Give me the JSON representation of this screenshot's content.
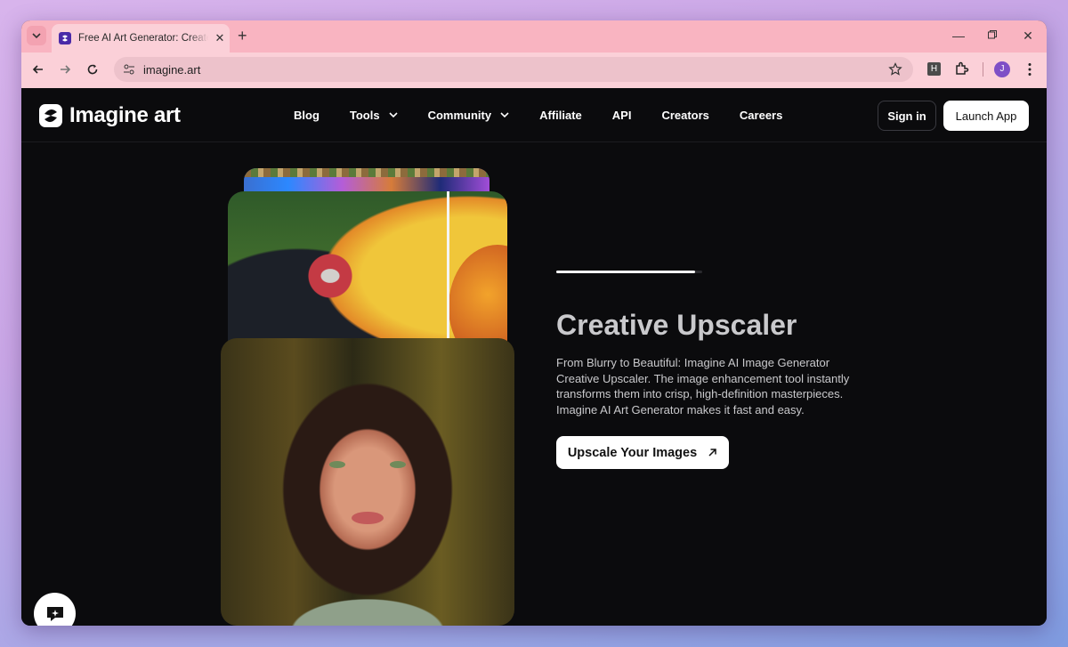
{
  "browser": {
    "tab_title": "Free AI Art Generator: Create AI Art",
    "url": "imagine.art",
    "profile_initial": "J",
    "extension_label": "H"
  },
  "site": {
    "logo_text": "Imagine art",
    "nav": [
      {
        "label": "Blog"
      },
      {
        "label": "Tools"
      },
      {
        "label": "Community"
      },
      {
        "label": "Affiliate"
      },
      {
        "label": "API"
      },
      {
        "label": "Creators"
      },
      {
        "label": "Careers"
      }
    ],
    "signin_label": "Sign in",
    "launch_label": "Launch App"
  },
  "hero": {
    "title": "Creative Upscaler",
    "description": "From Blurry to Beautiful: Imagine AI Image Generator Creative Upscaler. The image enhancement tool instantly transforms them into crisp, high-definition masterpieces. Imagine AI Art Generator makes it fast and easy.",
    "cta_label": "Upscale Your Images",
    "slide_progress": 0.95
  },
  "colors": {
    "tab_strip": "#f9b4c1",
    "toolbar": "#fbd0d8",
    "site_bg": "#0b0b0d",
    "accent_white": "#ffffff"
  }
}
